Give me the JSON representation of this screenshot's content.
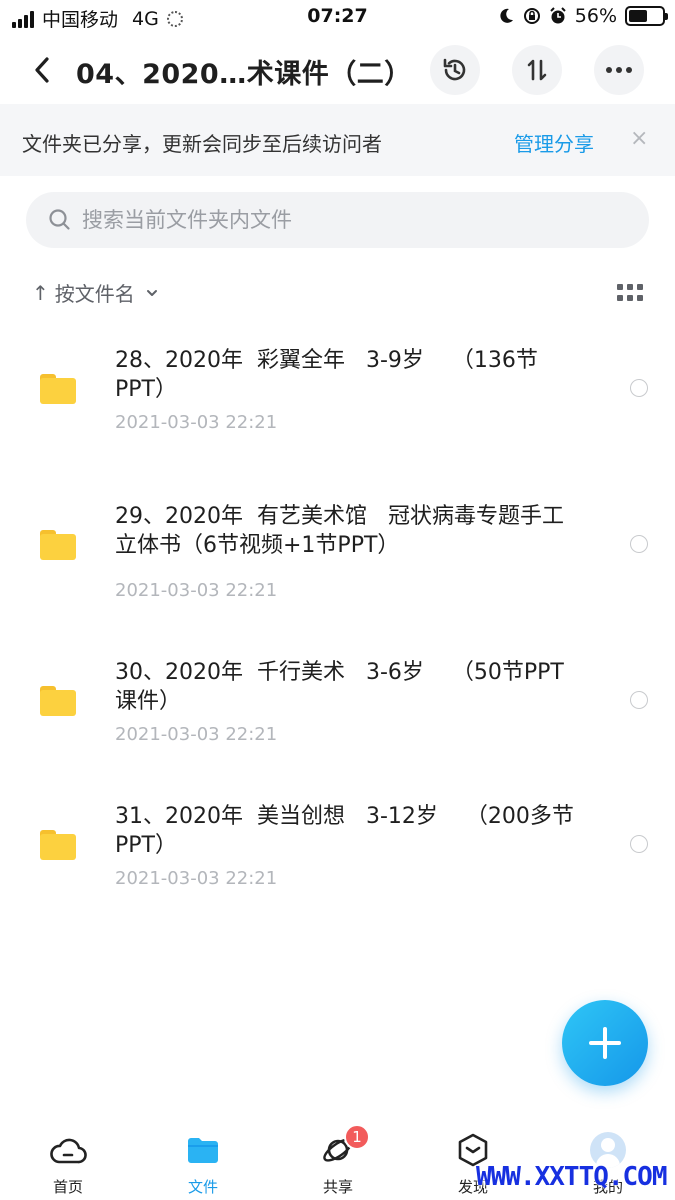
{
  "status_bar": {
    "carrier": "中国移动",
    "network": "4G",
    "time": "07:27",
    "battery": "56%",
    "battery_level": 0.56
  },
  "nav": {
    "title": "04、2020…术课件（二）"
  },
  "share_banner": {
    "text": "文件夹已分享，更新会同步至后续访问者",
    "manage_label": "管理分享",
    "close_label": "×"
  },
  "search": {
    "placeholder": "搜索当前文件夹内文件",
    "value": ""
  },
  "sort": {
    "arrow": "↑",
    "label": "按文件名"
  },
  "files": [
    {
      "name": "28、2020年  彩翼全年   3-9岁    （136节PPT）",
      "date": "2021-03-03 22:21"
    },
    {
      "name": "29、2020年  有艺美术馆   冠状病毒专题手工立体书（6节视频+1节PPT）",
      "date": "2021-03-03 22:21"
    },
    {
      "name": "30、2020年  千行美术   3-6岁    （50节PPT课件）",
      "date": "2021-03-03 22:21"
    },
    {
      "name": "31、2020年  美当创想   3-12岁    （200多节PPT）",
      "date": "2021-03-03 22:21"
    }
  ],
  "tabs": [
    {
      "label": "首页",
      "icon": "cloud-icon"
    },
    {
      "label": "文件",
      "icon": "folder-icon"
    },
    {
      "label": "共享",
      "icon": "share-planet-icon",
      "badge": "1"
    },
    {
      "label": "发现",
      "icon": "discover-box-icon"
    },
    {
      "label": "我的",
      "icon": "avatar-icon"
    }
  ],
  "watermark": "WWW.XXTTQ.COM",
  "colors": {
    "accent": "#1a9be8",
    "folder": "#fcd13f",
    "badge": "#f25b5b"
  }
}
